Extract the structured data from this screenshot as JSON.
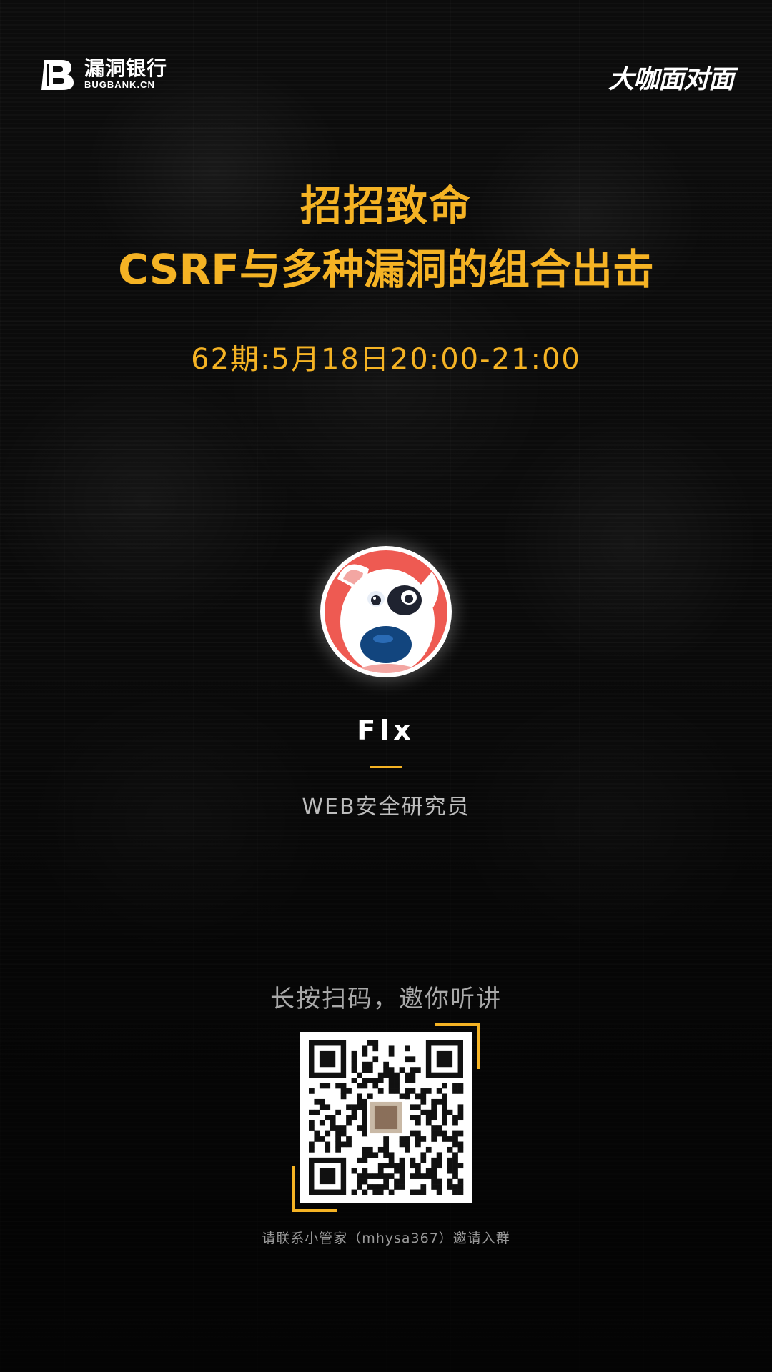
{
  "header": {
    "brand_name": "漏洞银行",
    "brand_domain": "BUGBANK.CN",
    "program_name": "大咖面对面"
  },
  "event": {
    "title_line1": "招招致命",
    "title_line2": "CSRF与多种漏洞的组合出击",
    "schedule": "62期:5月18日20:00-21:00"
  },
  "speaker": {
    "name": "Flx",
    "role": "WEB安全研究员",
    "avatar_icon": "cartoon-dog-avatar-icon"
  },
  "qr_section": {
    "scan_hint": "长按扫码，邀你听讲",
    "contact": "请联系小管家（mhysa367）邀请入群"
  },
  "colors": {
    "accent": "#f5b324",
    "background": "#0b0b0b",
    "avatar_bg": "#ee5a52"
  }
}
